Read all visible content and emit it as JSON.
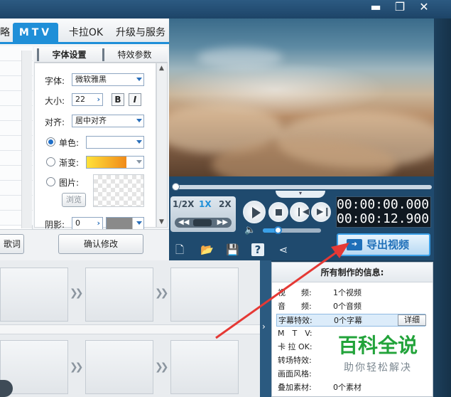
{
  "tabs": {
    "partial_left": "略",
    "mtv": "MTV",
    "karaoke": "卡拉OK",
    "upgrade": "升级与服务"
  },
  "subtabs": {
    "font_settings": "字体设置",
    "effect_params": "特效参数"
  },
  "settings": {
    "font_label": "字体:",
    "font_value": "微软雅黑",
    "size_label": "大小:",
    "size_value": "22",
    "bold": "B",
    "italic": "I",
    "align_label": "对齐:",
    "align_value": "居中对齐",
    "solid_label": "单色:",
    "gradient_label": "渐变:",
    "image_label": "图片:",
    "browse_label": "浏览",
    "shadow_label": "阴影:",
    "shadow_value": "0"
  },
  "buttons": {
    "lyrics_partial": "歌词",
    "confirm": "确认修改",
    "export": "导出视频"
  },
  "playback": {
    "speeds": [
      "1/2X",
      "1X",
      "2X"
    ],
    "current_time": "00:00:00.000",
    "total_time": "00:00:12.900",
    "progress": 0.0,
    "volume": 0.25
  },
  "info_panel": {
    "title": "所有制作的信息:",
    "rows": [
      {
        "key": "视　　频:",
        "value": "1个视频"
      },
      {
        "key": "音　　频:",
        "value": "0个音频"
      },
      {
        "key": "字幕特效:",
        "value": "0个字幕"
      },
      {
        "key": "M　T　V:",
        "value": ""
      },
      {
        "key": "卡 拉 OK:",
        "value": ""
      },
      {
        "key": "转场特效:",
        "value": ""
      },
      {
        "key": "画面风格:",
        "value": ""
      },
      {
        "key": "叠加素材:",
        "value": "0个素材"
      }
    ],
    "detail_button": "详细"
  },
  "watermark": {
    "main": "百科全说",
    "sub": "助你轻松解决"
  },
  "colors": {
    "accent": "#1f8fd8",
    "dark_bg": "#1f4a6e",
    "watermark_green": "#22a33a",
    "annotation_red": "#e53935"
  }
}
